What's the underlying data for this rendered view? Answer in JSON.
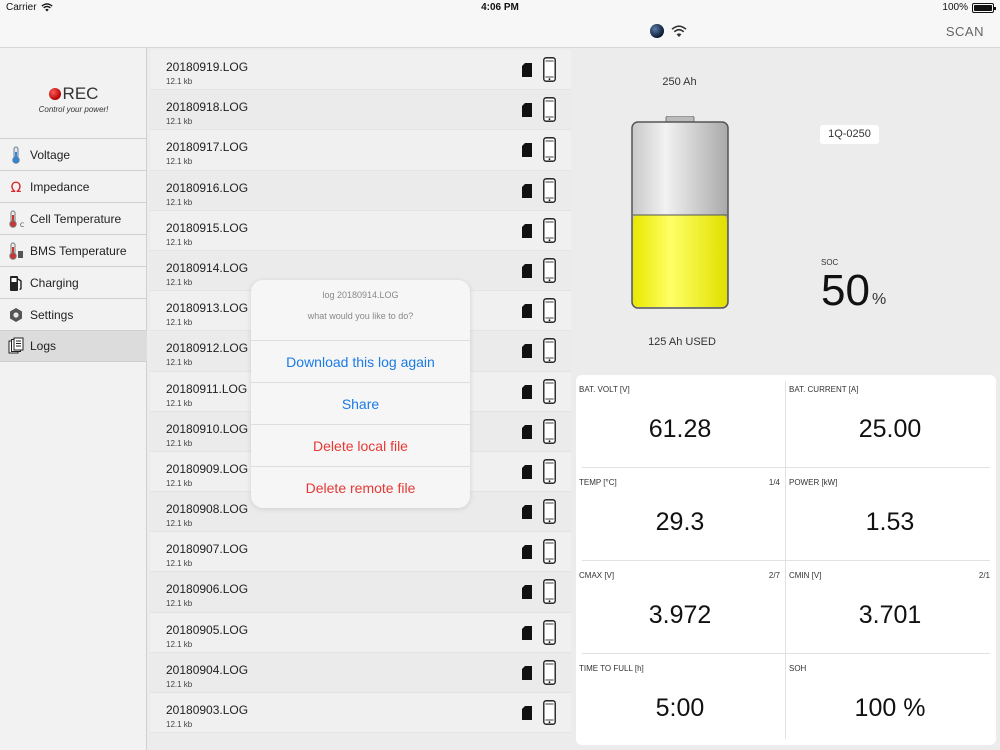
{
  "status_bar": {
    "carrier": "Carrier",
    "time": "4:06 PM",
    "battery_percent": "100%"
  },
  "nav": {
    "scan_label": "SCAN",
    "connection_icon": "bluetooth-status-dot",
    "wifi_icon": "wifi-icon"
  },
  "logo": {
    "brand": "REC",
    "tagline": "Control your power!"
  },
  "menu": [
    {
      "label": "Voltage",
      "icon": "thermometer-blue-icon"
    },
    {
      "label": "Impedance",
      "icon": "omega-icon"
    },
    {
      "label": "Cell Temperature",
      "icon": "thermometer-celsius-icon"
    },
    {
      "label": "BMS Temperature",
      "icon": "thermometer-bms-icon"
    },
    {
      "label": "Charging",
      "icon": "fuel-pump-icon"
    },
    {
      "label": "Settings",
      "icon": "hex-nut-icon"
    },
    {
      "label": "Logs",
      "icon": "documents-icon",
      "active": true
    }
  ],
  "files": [
    {
      "name": "20180919.LOG",
      "size": "12.1 kb"
    },
    {
      "name": "20180918.LOG",
      "size": "12.1 kb"
    },
    {
      "name": "20180917.LOG",
      "size": "12.1 kb"
    },
    {
      "name": "20180916.LOG",
      "size": "12.1 kb"
    },
    {
      "name": "20180915.LOG",
      "size": "12.1 kb"
    },
    {
      "name": "20180914.LOG",
      "size": "12.1 kb"
    },
    {
      "name": "20180913.LOG",
      "size": "12.1 kb"
    },
    {
      "name": "20180912.LOG",
      "size": "12.1 kb"
    },
    {
      "name": "20180911.LOG",
      "size": "12.1 kb"
    },
    {
      "name": "20180910.LOG",
      "size": "12.1 kb"
    },
    {
      "name": "20180909.LOG",
      "size": "12.1 kb"
    },
    {
      "name": "20180908.LOG",
      "size": "12.1 kb"
    },
    {
      "name": "20180907.LOG",
      "size": "12.1 kb"
    },
    {
      "name": "20180906.LOG",
      "size": "12.1 kb"
    },
    {
      "name": "20180905.LOG",
      "size": "12.1 kb"
    },
    {
      "name": "20180904.LOG",
      "size": "12.1 kb"
    },
    {
      "name": "20180903.LOG",
      "size": "12.1 kb"
    }
  ],
  "dialog": {
    "title": "log 20180914.LOG",
    "message": "what would you like to do?",
    "download_label": "Download this log again",
    "share_label": "Share",
    "delete_local_label": "Delete local file",
    "delete_remote_label": "Delete remote file"
  },
  "battery": {
    "capacity": "250 Ah",
    "used": "125 Ah USED",
    "serial": "1Q-0250",
    "soc_label": "SOC",
    "soc_value": "50",
    "soc_unit": "%",
    "soc_fraction": 0.5,
    "fill_color": "#f4f400"
  },
  "metrics": [
    {
      "label": "BAT. VOLT [V]",
      "value": "61.28",
      "extra": ""
    },
    {
      "label": "BAT. CURRENT [A]",
      "value": "25.00",
      "extra": ""
    },
    {
      "label": "TEMP [°C]",
      "value": "29.3",
      "extra": "1/4"
    },
    {
      "label": "POWER [kW]",
      "value": "1.53",
      "extra": ""
    },
    {
      "label": "CMAX [V]",
      "value": "3.972",
      "extra": "2/7"
    },
    {
      "label": "CMIN [V]",
      "value": "3.701",
      "extra": "2/1"
    },
    {
      "label": "TIME TO FULL [h]",
      "value": "5:00",
      "extra": ""
    },
    {
      "label": "SOH",
      "value": "100 %",
      "extra": ""
    }
  ]
}
